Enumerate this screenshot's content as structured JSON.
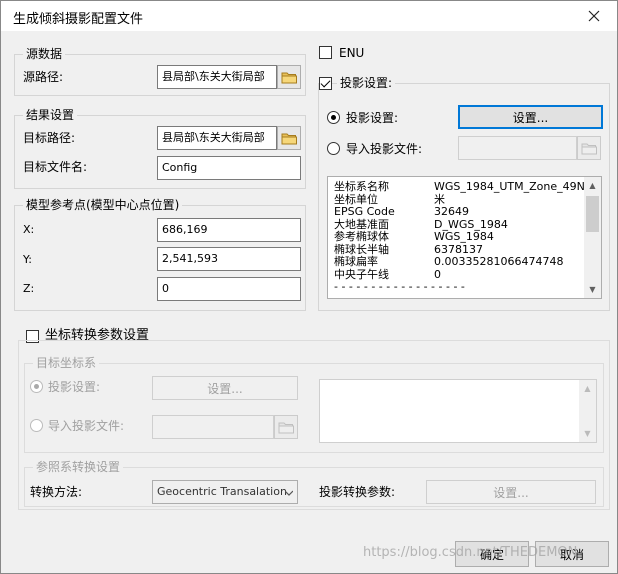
{
  "window": {
    "title": "生成倾斜摄影配置文件"
  },
  "source": {
    "legend": "源数据",
    "path_label": "源路径:",
    "path_value": "县局部\\东关大街局部"
  },
  "result": {
    "legend": "结果设置",
    "target_path_label": "目标路径:",
    "target_path_value": "县局部\\东关大街局部",
    "target_name_label": "目标文件名:",
    "target_name_value": "Config"
  },
  "ref_point": {
    "legend": "模型参考点(模型中心点位置)",
    "x_label": "X:",
    "x_value": "686,169",
    "y_label": "Y:",
    "y_value": "2,541,593",
    "z_label": "Z:",
    "z_value": "0"
  },
  "enu": {
    "label": "ENU",
    "checked": false
  },
  "projection": {
    "label": "投影设置:",
    "checked": true,
    "radio_setting_label": "投影设置:",
    "setting_button": "设置...",
    "radio_import_label": "导入投影文件:",
    "info": [
      {
        "key": "坐标系名称",
        "value": "WGS_1984_UTM_Zone_49N"
      },
      {
        "key": "坐标单位",
        "value": "米"
      },
      {
        "key": "EPSG Code",
        "value": "32649"
      },
      {
        "key": "大地基准面",
        "value": "D_WGS_1984"
      },
      {
        "key": "参考椭球体",
        "value": "WGS_1984"
      },
      {
        "key": "椭球长半轴",
        "value": "6378137"
      },
      {
        "key": "椭球扁率",
        "value": "0.00335281066474748"
      },
      {
        "key": "中央子午线",
        "value": "0"
      },
      {
        "key": "- - - - - - - - - - - - - - - - - -",
        "value": ""
      }
    ]
  },
  "transform": {
    "label": "坐标转换参数设置",
    "checked": false,
    "target_cs_legend": "目标坐标系",
    "radio_setting_label": "投影设置:",
    "setting_button": "设置...",
    "radio_import_label": "导入投影文件:",
    "ref_legend": "参照系转换设置",
    "method_label": "转换方法:",
    "method_value": "Geocentric Transalation",
    "params_label": "投影转换参数:",
    "params_button": "设置..."
  },
  "footer": {
    "ok": "确定",
    "cancel": "取消"
  },
  "watermark": "https://blog.csdn.net/THEDEMON"
}
